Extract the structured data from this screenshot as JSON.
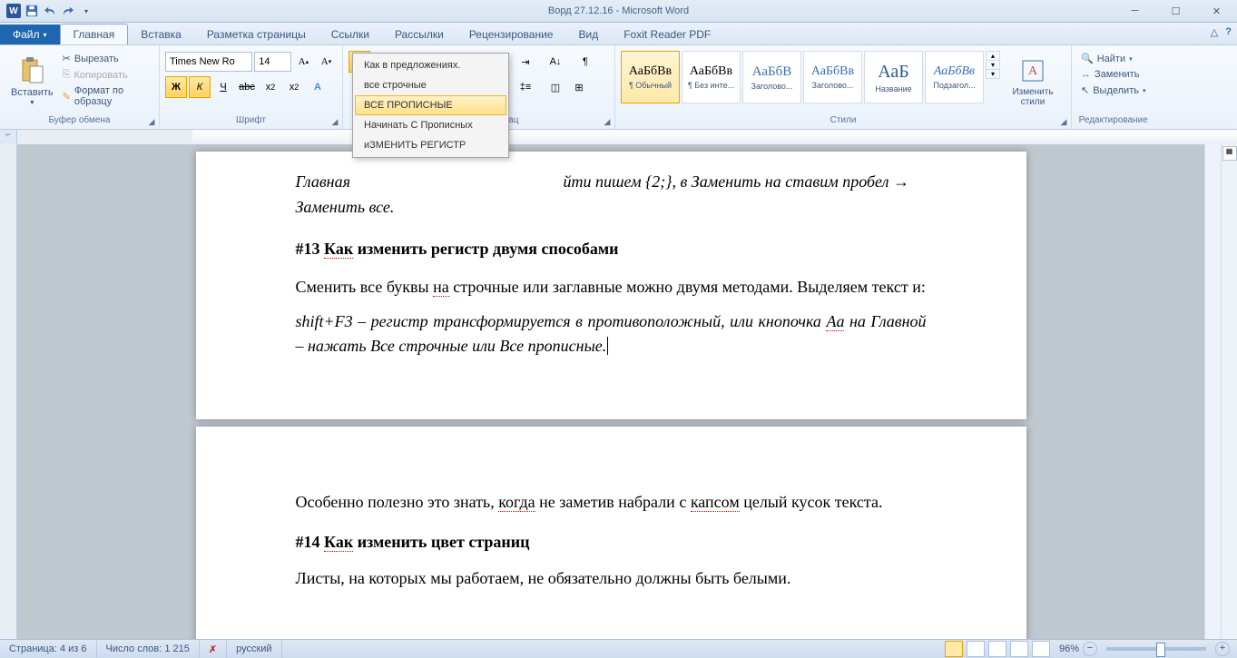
{
  "title": "Ворд 27.12.16 - Microsoft Word",
  "tabs": {
    "file": "Файл",
    "items": [
      "Главная",
      "Вставка",
      "Разметка страницы",
      "Ссылки",
      "Рассылки",
      "Рецензирование",
      "Вид",
      "Foxit Reader PDF"
    ],
    "active": 0
  },
  "clipboard": {
    "paste": "Вставить",
    "cut": "Вырезать",
    "copy": "Копировать",
    "format_painter": "Формат по образцу",
    "label": "Буфер обмена"
  },
  "font": {
    "name": "Times New Ro",
    "size": "14",
    "label": "Шрифт"
  },
  "paragraph": {
    "label": "зац"
  },
  "case_menu": {
    "sentence": "Как в предложениях.",
    "lower": "все строчные",
    "upper": "ВСЕ ПРОПИСНЫЕ",
    "title": "Начинать С Прописных",
    "toggle": "иЗМЕНИТЬ РЕГИСТР"
  },
  "styles": {
    "label": "Стили",
    "change": "Изменить стили",
    "items": [
      {
        "preview": "АаБбВв",
        "name": "¶ Обычный"
      },
      {
        "preview": "АаБбВв",
        "name": "¶ Без инте..."
      },
      {
        "preview": "АаБбВ",
        "name": "Заголово..."
      },
      {
        "preview": "АаБбВв",
        "name": "Заголово..."
      },
      {
        "preview": "АаБ",
        "name": "Название"
      },
      {
        "preview": "АаБбВв",
        "name": "Подзагол..."
      }
    ]
  },
  "editing": {
    "find": "Найти",
    "replace": "Заменить",
    "select": "Выделить",
    "label": "Редактирование"
  },
  "doc": {
    "p1a": "Главная ",
    "p1b": "йти пишем {2;}, в Заменить на ставим пробел → Заменить все.",
    "h13": "#13 Как изменить регистр двумя способами",
    "p2": "Сменить все буквы на строчные или заглавные можно двумя методами. Выделяем текст и:",
    "p3": "shift+F3 – регистр трансформируется в противоположный, или кнопочка Aa на Главной – нажать Все строчные или Все прописные.",
    "p4a": "Особенно полезно это знать, ",
    "p4b": "когда",
    "p4c": " не заметив набрали с ",
    "p4d": "капсом",
    "p4e": " целый кусок текста.",
    "h14": "#14 Как изменить цвет страниц",
    "p5": "Листы, на которых мы работаем, не обязательно должны быть белыми."
  },
  "status": {
    "page": "Страница: 4 из 6",
    "words": "Число слов: 1 215",
    "lang": "русский",
    "zoom": "96%"
  }
}
